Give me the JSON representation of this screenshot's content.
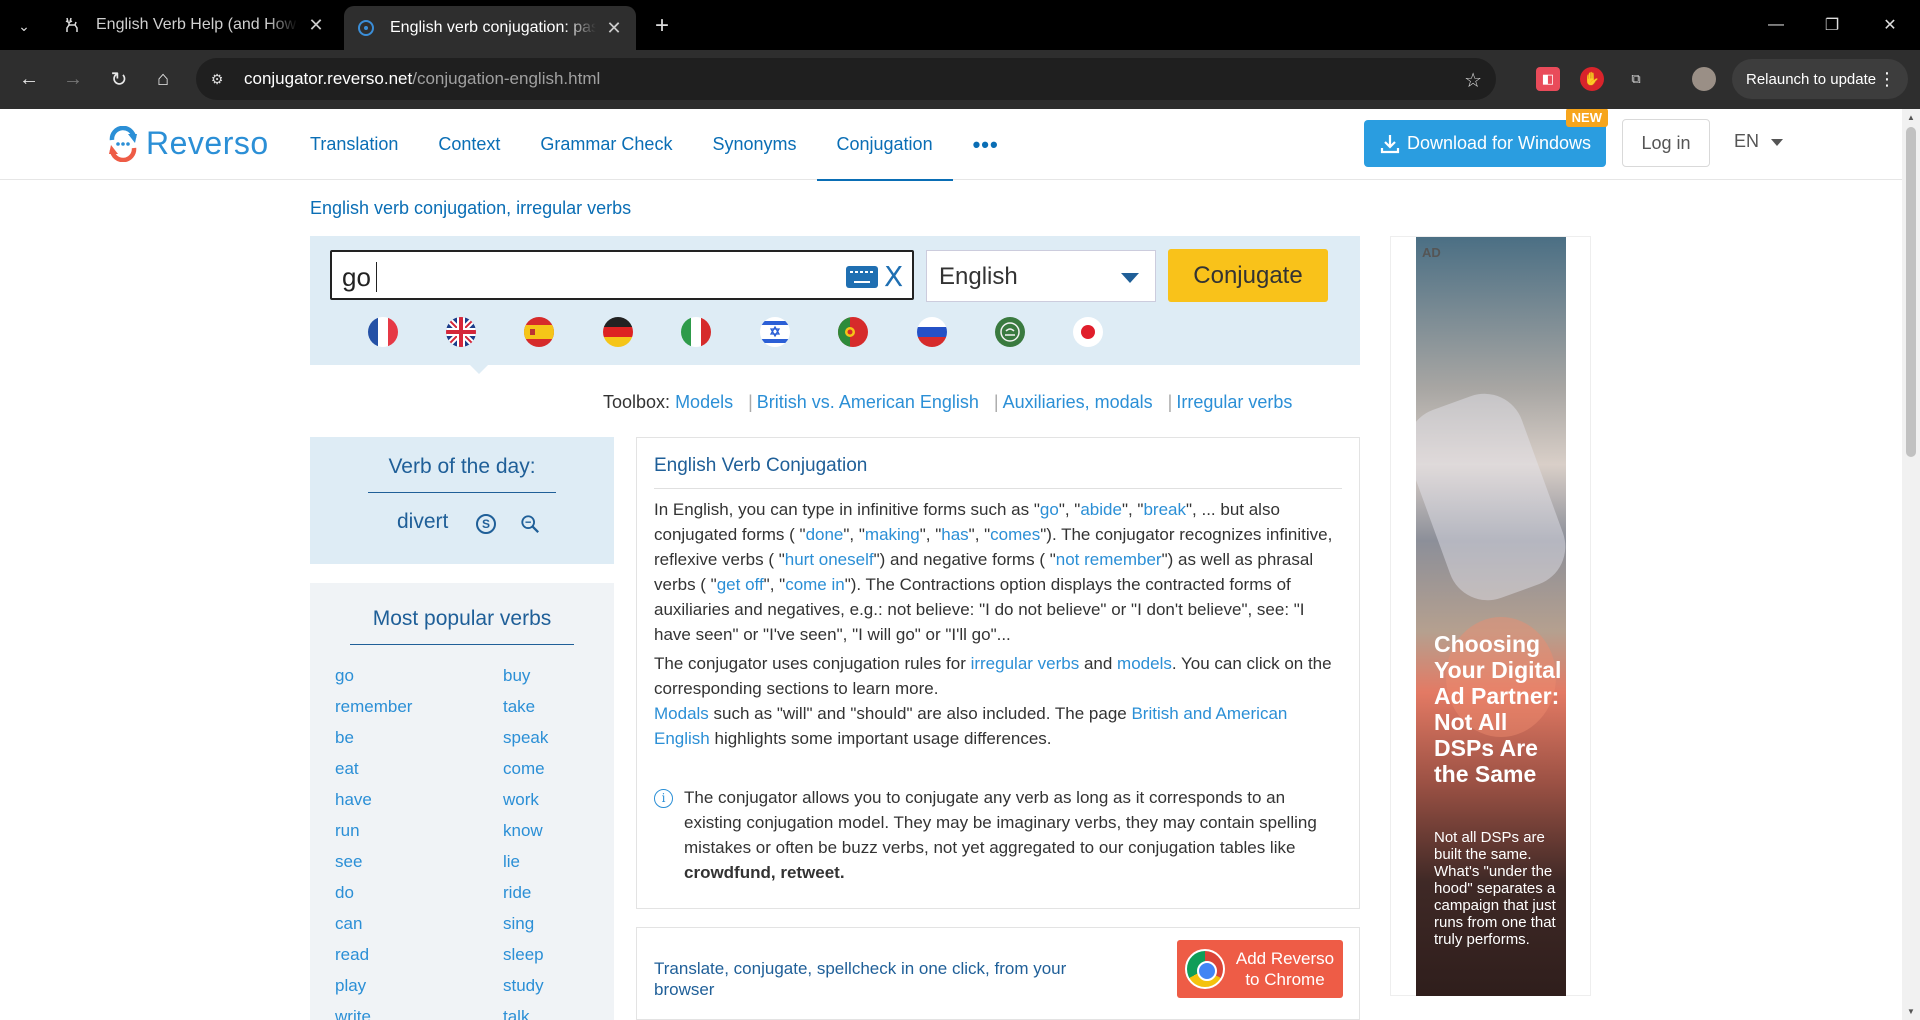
{
  "browser": {
    "tabs": [
      {
        "title": "English Verb Help (and How to",
        "active": false
      },
      {
        "title": "English verb conjugation: past t",
        "active": true
      }
    ],
    "url_host": "conjugator.reverso.net",
    "url_path": "/conjugation-english.html",
    "relaunch_label": "Relaunch to update"
  },
  "header": {
    "logo_text": "Reverso",
    "nav": [
      "Translation",
      "Context",
      "Grammar Check",
      "Synonyms",
      "Conjugation"
    ],
    "active_nav": "Conjugation",
    "more_label": "•••",
    "download_label": "Download for Windows",
    "new_badge": "NEW",
    "login_label": "Log in",
    "lang_label": "EN"
  },
  "breadcrumb": "English verb conjugation, irregular verbs",
  "search": {
    "value": "go",
    "clear_label": "X",
    "language": "English",
    "button_label": "Conjugate",
    "flags": [
      "france",
      "uk",
      "spain",
      "germany",
      "italy",
      "israel",
      "portugal",
      "russia",
      "arabic",
      "japan"
    ],
    "selected_flag": "uk"
  },
  "toolbox": {
    "label": "Toolbox:",
    "links": [
      "Models",
      "British vs. American English",
      "Auxiliaries, modals",
      "Irregular verbs"
    ]
  },
  "verb_of_day": {
    "heading": "Verb of the day:",
    "verb": "divert"
  },
  "popular": {
    "heading": "Most popular verbs",
    "col1": [
      "go",
      "remember",
      "be",
      "eat",
      "have",
      "run",
      "see",
      "do",
      "can",
      "read",
      "play",
      "write"
    ],
    "col2": [
      "buy",
      "take",
      "speak",
      "come",
      "work",
      "know",
      "lie",
      "ride",
      "sing",
      "sleep",
      "study",
      "talk"
    ]
  },
  "info": {
    "heading": "English Verb Conjugation",
    "p1": {
      "t1": "In English, you can type in infinitive forms such as \"",
      "l1": "go",
      "t2": "\", \"",
      "l2": "abide",
      "t3": "\", \"",
      "l3": "break",
      "t4": "\", ... but also conjugated forms ( \"",
      "l4": "done",
      "t5": "\", \"",
      "l5": "making",
      "t6": "\", \"",
      "l6": "has",
      "t7": "\", \"",
      "l7": "comes",
      "t8": "\"). The conjugator recognizes infinitive, reflexive verbs ( \"",
      "l8": "hurt oneself",
      "t9": "\") and negative forms ( \"",
      "l9": "not remember",
      "t10": "\") as well as phrasal verbs ( \"",
      "l10": "get off",
      "t11": "\", \"",
      "l11": "come in",
      "t12": "\"). The Contractions option displays the contracted forms of auxiliaries and negatives, e.g.: not believe: \"I do not believe\" or \"I don't believe\", see: \"I have seen\" or \"I've seen\", \"I will go\" or \"I'll go\"..."
    },
    "p2": {
      "t1": "The conjugator uses conjugation rules for ",
      "l1": "irregular verbs",
      "t2": " and ",
      "l2": "models",
      "t3": ". You can click on the corresponding sections to learn more."
    },
    "p3": {
      "l1": "Modals",
      "t1": " such as \"will\" and \"should\" are also included. The page ",
      "l2": "British and American English",
      "t2": " highlights some important usage differences."
    },
    "note": {
      "icon": "i",
      "text": "The conjugator allows you to conjugate any verb as long as it corresponds to an existing conjugation model. They may be imaginary verbs, they may contain spelling mistakes or often be buzz verbs, not yet aggregated to our conjugation tables like ",
      "bold": "crowdfund, retweet."
    }
  },
  "promo": {
    "text": "Translate, conjugate, spellcheck in one click, from your browser",
    "button": "Add Reverso to Chrome"
  },
  "ad": {
    "tag": "AD",
    "headline": "Choosing Your Digital Ad Partner: Not All DSPs Are the Same",
    "body": "Not all DSPs are built the same. What's \"under the hood\" separates a campaign that just runs from one that truly performs."
  },
  "colors": {
    "brand_blue": "#2b8fd6",
    "conjugate_yellow": "#f9c21a",
    "download_blue": "#2a9de0"
  }
}
